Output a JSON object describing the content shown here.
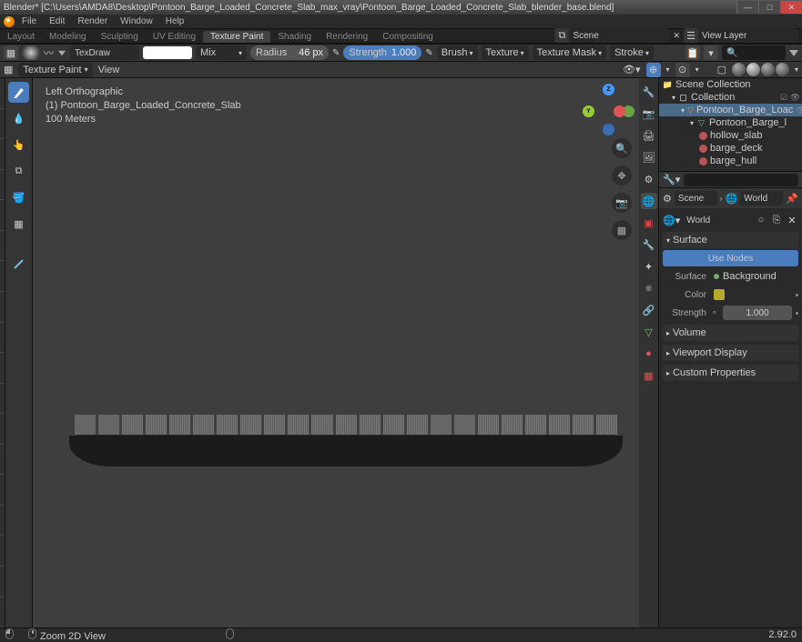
{
  "titlebar": {
    "text": "Blender* [C:\\Users\\AMDA8\\Desktop\\Pontoon_Barge_Loaded_Concrete_Slab_max_vray\\Pontoon_Barge_Loaded_Concrete_Slab_blender_base.blend]"
  },
  "menubar": [
    "File",
    "Edit",
    "Render",
    "Window",
    "Help"
  ],
  "workspace_tabs": [
    "Layout",
    "Modeling",
    "Sculpting",
    "UV Editing",
    "Texture Paint",
    "Shading",
    "Rendering",
    "Compositing"
  ],
  "workspace_active": "Texture Paint",
  "scene_selector": {
    "label": "Scene"
  },
  "viewlayer_selector": {
    "label": "View Layer"
  },
  "tool_header": {
    "brush_name": "TexDraw",
    "blend_mode": "Mix",
    "radius": {
      "label": "Radius",
      "value": "46 px"
    },
    "strength": {
      "label": "Strength",
      "value": "1.000"
    },
    "dropdowns": [
      "Brush",
      "Texture",
      "Texture Mask",
      "Stroke"
    ]
  },
  "header2": {
    "mode": "Texture Paint",
    "menu": "View"
  },
  "viewport_overlay": {
    "line1": "Left Orthographic",
    "line2": "(1) Pontoon_Barge_Loaded_Concrete_Slab",
    "line3": "100 Meters"
  },
  "orbit_gizmo": {
    "axes": {
      "y": "Y",
      "z": "Z"
    }
  },
  "outliner": {
    "title": "Scene Collection",
    "collection": "Collection",
    "root": "Pontoon_Barge_Loac",
    "child": "Pontoon_Barge_l",
    "meshes": [
      "hollow_slab",
      "barge_deck",
      "barge_hull"
    ]
  },
  "breadcrumb": {
    "scene": "Scene",
    "world": "World"
  },
  "world_datablock": "World",
  "surface_panel": {
    "title": "Surface",
    "use_nodes": "Use Nodes",
    "surface": {
      "label": "Surface",
      "value": "Background"
    },
    "color": {
      "label": "Color"
    },
    "strength": {
      "label": "Strength",
      "value": "1.000"
    }
  },
  "collapsed_panels": [
    "Volume",
    "Viewport Display",
    "Custom Properties"
  ],
  "statusbar": {
    "hint": "Zoom 2D View",
    "version": "2.92.0"
  }
}
